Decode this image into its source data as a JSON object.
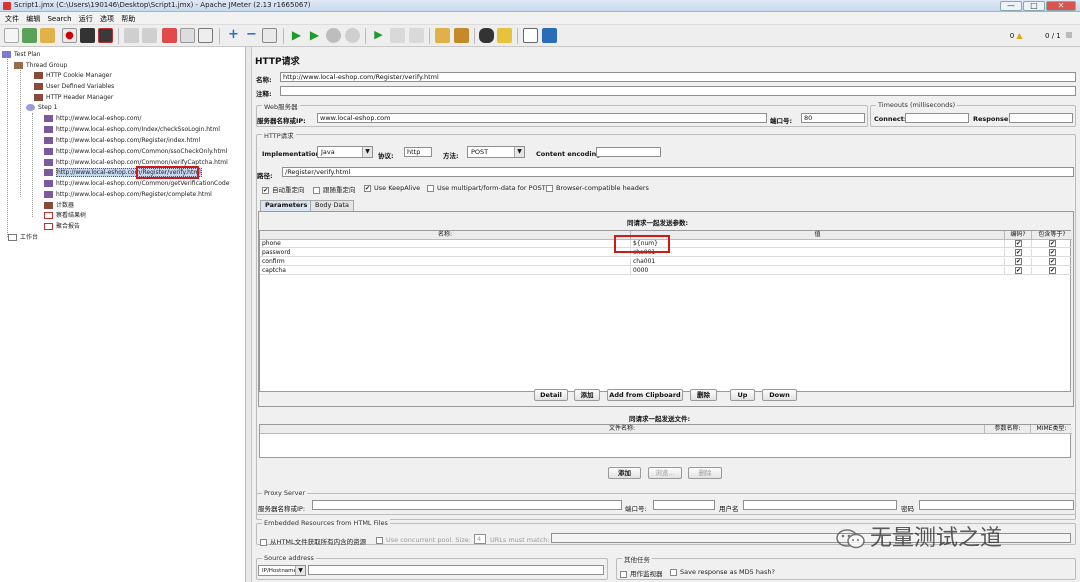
{
  "window": {
    "title": "Script1.jmx (C:\\Users\\190146\\Desktop\\Script1.jmx) - Apache JMeter (2.13 r1665067)",
    "min": "—",
    "max": "□",
    "close": "✕"
  },
  "menu": [
    "文件",
    "编辑",
    "Search",
    "运行",
    "选项",
    "帮助"
  ],
  "toolbar": {
    "warn_count": "0",
    "threads": "0 / 1"
  },
  "tree": {
    "test_plan": "Test Plan",
    "thread_group": "Thread Group",
    "cookie": "HTTP Cookie Manager",
    "vars": "User Defined Variables",
    "header": "HTTP Header Manager",
    "step": "Step 1",
    "req1": "http://www.local-eshop.com/",
    "req2": "http://www.local-eshop.com/Index/checkSsoLogin.html",
    "req3": "http://www.local-eshop.com/Register/index.html",
    "req4": "http://www.local-eshop.com/Common/ssoCheckOnly.html",
    "req5": "http://www.local-eshop.com/Common/verifyCaptcha.html",
    "req6": "http://www.local-eshop.com/Register/verify.html",
    "req7": "http://www.local-eshop.com/Common/getVerificationCode",
    "req8": "http://www.local-eshop.com/Register/complete.html",
    "counter": "计数器",
    "tree_listener": "察看结果树",
    "agg_listener": "聚合报告",
    "workbench": "工作台"
  },
  "form": {
    "heading": "HTTP请求",
    "name_label": "名称:",
    "name_value": "http://www.local-eshop.com/Register/verify.html",
    "comment_label": "注释:",
    "web_server": "Web服务器",
    "server_label": "服务器名称或IP:",
    "server_value": "www.local-eshop.com",
    "port_label": "端口号:",
    "port_value": "80",
    "timeouts": "Timeouts (milliseconds)",
    "connect_label": "Connect:",
    "response_label": "Response:",
    "http_request": "HTTP请求",
    "impl_label": "Implementation:",
    "impl_value": "Java",
    "protocol_label": "协议:",
    "protocol_value": "http",
    "method_label": "方法:",
    "method_value": "POST",
    "encoding_label": "Content encoding:",
    "path_label": "路径:",
    "path_value": "/Register/verify.html",
    "opt_redirect_auto": "自动重定向",
    "opt_redirect_follow": "跟随重定向",
    "opt_keepalive": "Use KeepAlive",
    "opt_multipart": "Use multipart/form-data for POST",
    "opt_browser_headers": "Browser-compatible headers"
  },
  "tabs": [
    "Parameters",
    "Body Data"
  ],
  "params": {
    "caption": "同请求一起发送参数:",
    "col_name": "名称:",
    "col_value": "值",
    "col_encode": "编码?",
    "col_include": "包含等于?",
    "rows": [
      {
        "name": "phone",
        "value": "${num}"
      },
      {
        "name": "password",
        "value": "cha001"
      },
      {
        "name": "confirm",
        "value": "cha001"
      },
      {
        "name": "captcha",
        "value": "0000"
      }
    ],
    "buttons": [
      "Detail",
      "添加",
      "Add from Clipboard",
      "删除",
      "Up",
      "Down"
    ]
  },
  "files": {
    "caption": "同请求一起发送文件:",
    "col_path": "文件名称:",
    "col_param": "参数名称:",
    "col_mime": "MIME类型:",
    "buttons": [
      "添加",
      "浏览...",
      "删除"
    ]
  },
  "proxy": {
    "title": "Proxy Server",
    "server_label": "服务器名称或IP:",
    "port_label": "端口号:",
    "user_label": "用户名",
    "pass_label": "密码"
  },
  "embedded": {
    "title": "Embedded Resources from HTML Files",
    "retrieve": "从HTML文件获取所有内含的资源",
    "concurrent": "Use concurrent pool. Size:",
    "pool_size": "4",
    "urls_match": "URLs must match:"
  },
  "source": {
    "title": "Source address",
    "type_value": "IP/Hostname"
  },
  "other": {
    "title": "其他任务",
    "monitor": "用作监视器",
    "md5": "Save response as MD5 hash?"
  },
  "watermark": "无量测试之道"
}
